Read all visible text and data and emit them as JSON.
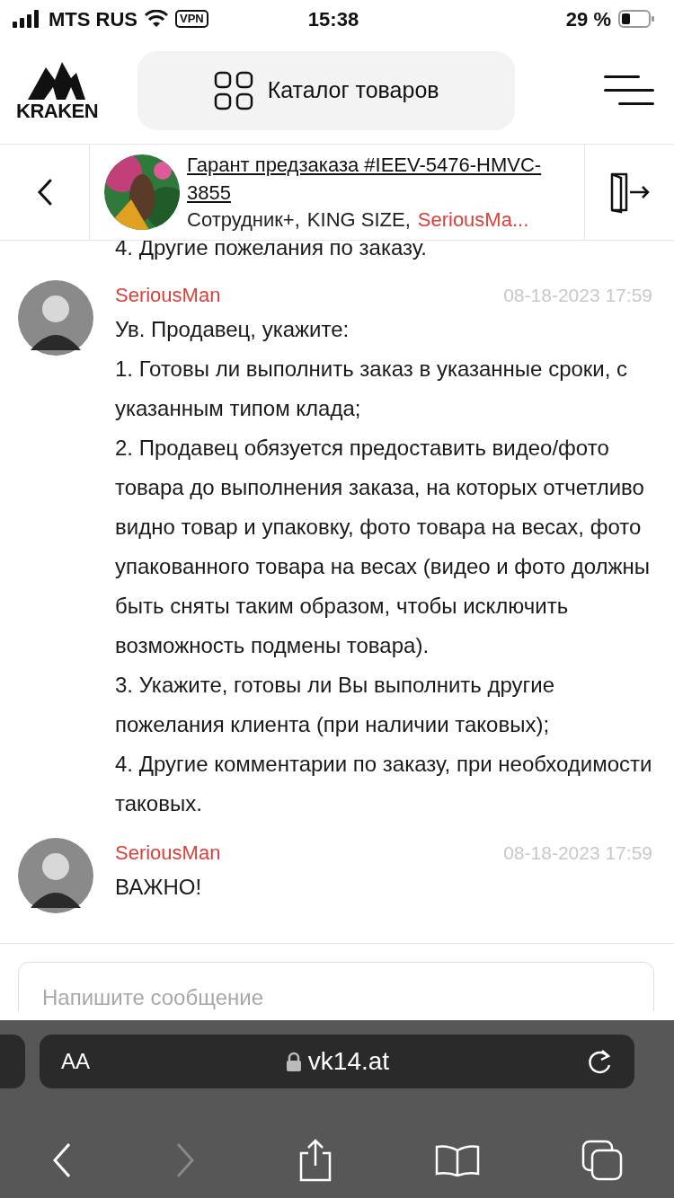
{
  "status_bar": {
    "carrier": "MTS RUS",
    "vpn": "VPN",
    "time": "15:38",
    "battery_text": "29 %"
  },
  "header": {
    "logo_text": "KRAKEN",
    "catalog_button": "Каталог товаров"
  },
  "chat_header": {
    "title": "Гарант предзаказа #IEEV-5476-HMVC-3855",
    "participants": [
      {
        "name": "Сотрудник+,",
        "highlighted": false
      },
      {
        "name": "KING SIZE,",
        "highlighted": false
      },
      {
        "name": "SeriousMa...",
        "highlighted": true
      }
    ]
  },
  "previous_line": "4. Другие пожелания по заказу.",
  "messages": [
    {
      "author": "SeriousMan",
      "time": "08-18-2023 17:59",
      "lines": [
        "Ув. Продавец, укажите:",
        "1. Готовы ли выполнить заказ в указанные сроки, с указанным типом клада;",
        "2. Продавец обязуется предоставить видео/фото товара до выполнения заказа, на которых отчетливо видно товар и упаковку, фото товара на весах, фото упакованного товара на весах (видео и фото должны быть сняты таким образом, чтобы исключить возможность подмены товара).",
        "3. Укажите, готовы ли Вы выполнить другие пожелания клиента (при наличии таковых);",
        "4. Другие комментарии по заказу, при необходимости таковых."
      ]
    },
    {
      "author": "SeriousMan",
      "time": "08-18-2023 17:59",
      "lines": [
        "ВАЖНО!"
      ]
    }
  ],
  "composer": {
    "placeholder": "Напишите сообщение"
  },
  "browser": {
    "text_size": "AA",
    "url": "vk14.at"
  }
}
